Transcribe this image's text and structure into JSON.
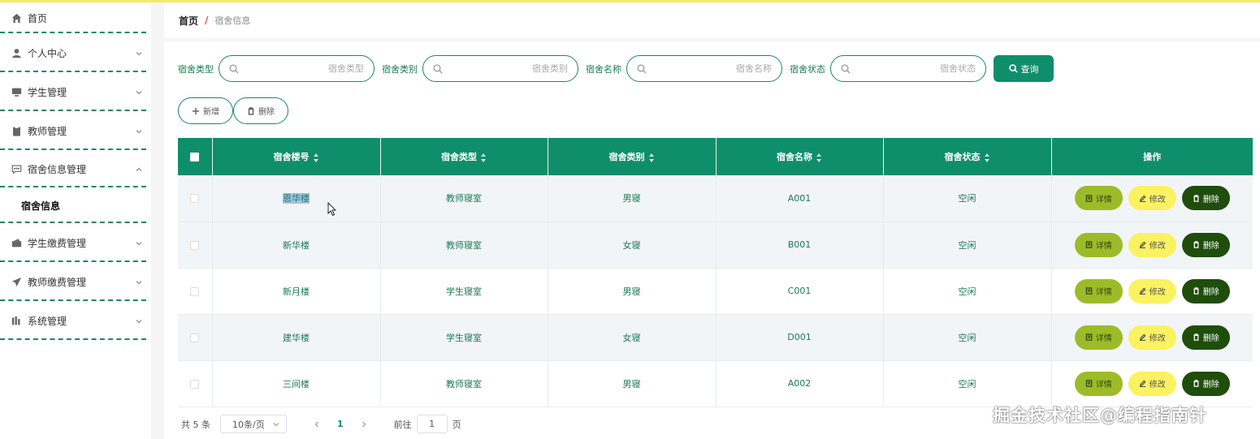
{
  "sidebar": {
    "items": [
      {
        "label": "首页",
        "icon": "home-icon"
      },
      {
        "label": "个人中心",
        "icon": "user-icon",
        "expandable": true
      },
      {
        "label": "学生管理",
        "icon": "monitor-icon",
        "expandable": true
      },
      {
        "label": "教师管理",
        "icon": "clipboard-icon",
        "expandable": true
      },
      {
        "label": "宿舍信息管理",
        "icon": "chat-icon",
        "expandable": true,
        "expanded": true,
        "children": [
          {
            "label": "宿舍信息"
          }
        ]
      },
      {
        "label": "学生缴费管理",
        "icon": "wallet-icon",
        "expandable": true
      },
      {
        "label": "教师缴费管理",
        "icon": "send-icon",
        "expandable": true
      },
      {
        "label": "系统管理",
        "icon": "chart-icon",
        "expandable": true
      }
    ]
  },
  "breadcrumb": {
    "home": "首页",
    "separator": "/",
    "current": "宿舍信息"
  },
  "search": {
    "fields": [
      {
        "label": "宿舍类型",
        "placeholder": "宿舍类型"
      },
      {
        "label": "宿舍类别",
        "placeholder": "宿舍类别"
      },
      {
        "label": "宿舍名称",
        "placeholder": "宿舍名称"
      },
      {
        "label": "宿舍状态",
        "placeholder": "宿舍状态"
      }
    ],
    "query_label": "查询"
  },
  "actions": {
    "add_label": "新增",
    "delete_label": "删除"
  },
  "table": {
    "columns": [
      "宿舍楼号",
      "宿舍类型",
      "宿舍类别",
      "宿舍名称",
      "宿舍状态",
      "操作"
    ],
    "rows": [
      {
        "building": "恩华楼",
        "type": "教师寝室",
        "category": "男寝",
        "name": "A001",
        "status": "空闲"
      },
      {
        "building": "新华楼",
        "type": "教师寝室",
        "category": "女寝",
        "name": "B001",
        "status": "空闲"
      },
      {
        "building": "新月楼",
        "type": "学生寝室",
        "category": "男寝",
        "name": "C001",
        "status": "空闲"
      },
      {
        "building": "建华楼",
        "type": "学生寝室",
        "category": "女寝",
        "name": "D001",
        "status": "空闲"
      },
      {
        "building": "三间楼",
        "type": "教师寝室",
        "category": "男寝",
        "name": "A002",
        "status": "空闲"
      }
    ],
    "row_actions": {
      "detail": "详情",
      "edit": "修改",
      "delete": "删除"
    }
  },
  "pagination": {
    "total_text": "共 5 条",
    "page_size": "10条/页",
    "current_page": "1",
    "goto_prefix": "前往",
    "goto_value": "1",
    "goto_suffix": "页"
  },
  "watermark": "掘金技术社区@编程指南针",
  "colors": {
    "primary": "#0f8e6c",
    "detail": "#9dbb29",
    "edit": "#faf260",
    "delete": "#1f4d0c",
    "topline": "#f5ea62"
  }
}
